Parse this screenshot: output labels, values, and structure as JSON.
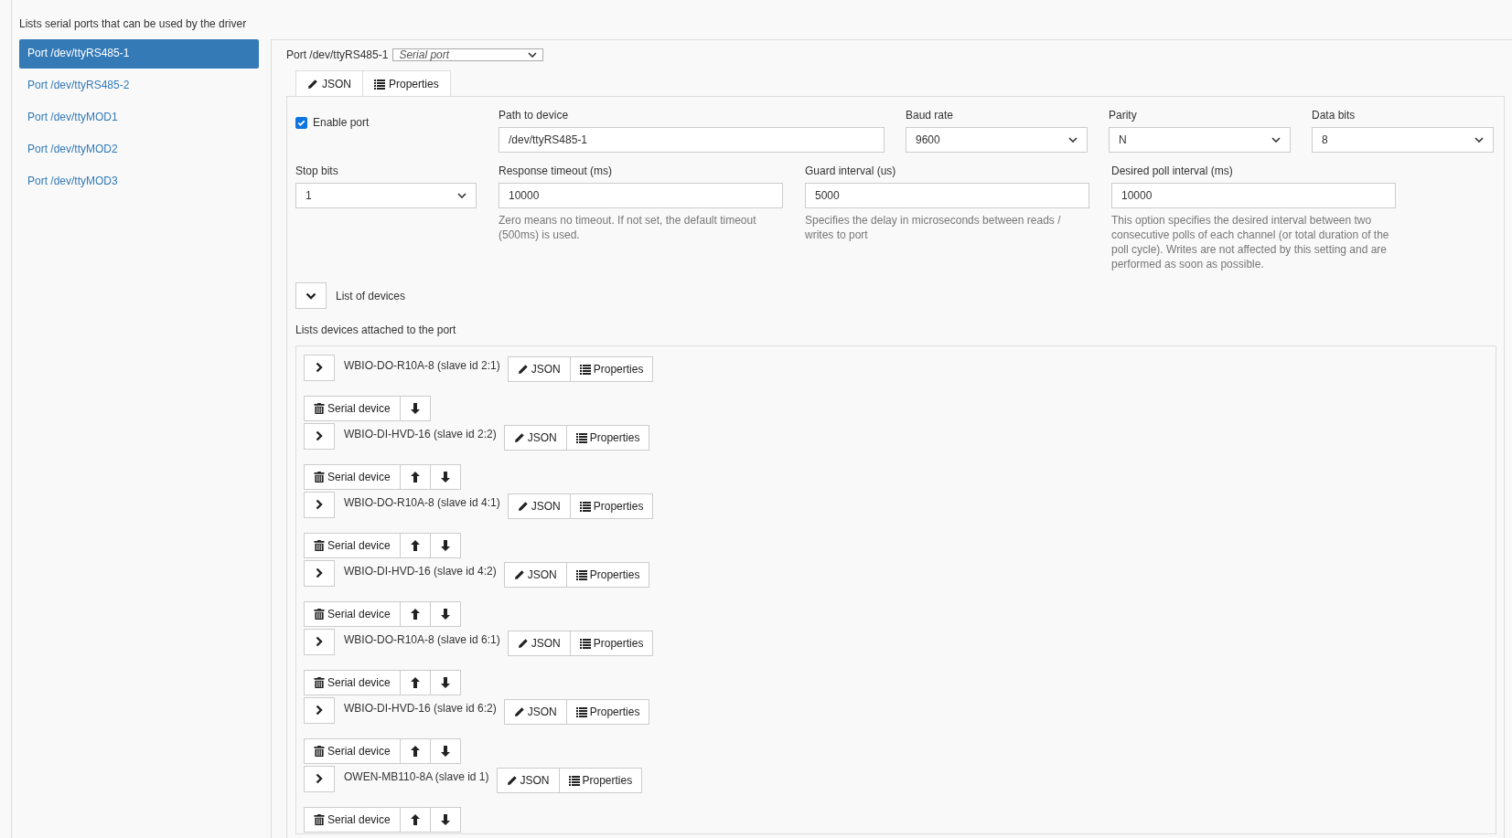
{
  "ports_heading": "Lists serial ports that can be used by the driver",
  "ports": [
    {
      "label": "Port /dev/ttyRS485-1",
      "selected": true
    },
    {
      "label": "Port /dev/ttyRS485-2",
      "selected": false
    },
    {
      "label": "Port /dev/ttyMOD1",
      "selected": false
    },
    {
      "label": "Port /dev/ttyMOD2",
      "selected": false
    },
    {
      "label": "Port /dev/ttyMOD3",
      "selected": false
    }
  ],
  "port_title": "Port /dev/ttyRS485-1",
  "port_type": "Serial port",
  "editor_tabs": [
    "JSON",
    "Properties"
  ],
  "enable_port": {
    "label": "Enable port",
    "checked": true
  },
  "row1": [
    {
      "kind": "input",
      "label": "Path to device",
      "value": "/dev/ttyRS485-1"
    },
    {
      "kind": "select",
      "label": "Baud rate",
      "value": "9600"
    },
    {
      "kind": "select",
      "label": "Parity",
      "value": "N"
    },
    {
      "kind": "select",
      "label": "Data bits",
      "value": "8"
    }
  ],
  "row2": [
    {
      "kind": "select",
      "label": "Stop bits",
      "value": "1"
    },
    {
      "kind": "input",
      "label": "Response timeout (ms)",
      "value": "10000",
      "help": "Zero means no timeout. If not set, the default timeout (500ms) is used."
    },
    {
      "kind": "input",
      "label": "Guard interval (us)",
      "value": "5000",
      "help": "Specifies the delay in microseconds between reads / writes to port"
    },
    {
      "kind": "input",
      "label": "Desired poll interval (ms)",
      "value": "10000",
      "help": "This option specifies the desired interval between two consecutive polls of each channel (or total duration of the poll cycle). Writes are not affected by this setting and are performed as soon as possible."
    }
  ],
  "devices_toggle": {
    "label": "List of devices",
    "expanded": true
  },
  "devices_heading": "Lists devices attached to the port",
  "devices": [
    {
      "name": "WBIO-DO-R10A-8 (slave id 2:1)",
      "json": "JSON",
      "properties": "Properties",
      "delete": "Serial device",
      "move_up": false,
      "move_down": true
    },
    {
      "name": "WBIO-DI-HVD-16 (slave id 2:2)",
      "json": "JSON",
      "properties": "Properties",
      "delete": "Serial device",
      "move_up": true,
      "move_down": true
    },
    {
      "name": "WBIO-DO-R10A-8 (slave id 4:1)",
      "json": "JSON",
      "properties": "Properties",
      "delete": "Serial device",
      "move_up": true,
      "move_down": true
    },
    {
      "name": "WBIO-DI-HVD-16 (slave id 4:2)",
      "json": "JSON",
      "properties": "Properties",
      "delete": "Serial device",
      "move_up": true,
      "move_down": true
    },
    {
      "name": "WBIO-DO-R10A-8 (slave id 6:1)",
      "json": "JSON",
      "properties": "Properties",
      "delete": "Serial device",
      "move_up": true,
      "move_down": true
    },
    {
      "name": "WBIO-DI-HVD-16 (slave id 6:2)",
      "json": "JSON",
      "properties": "Properties",
      "delete": "Serial device",
      "move_up": true,
      "move_down": true
    },
    {
      "name": "OWEN-MB110-8A (slave id 1)",
      "json": "JSON",
      "properties": "Properties",
      "delete": "Serial device",
      "move_up": true,
      "move_down": true
    }
  ]
}
